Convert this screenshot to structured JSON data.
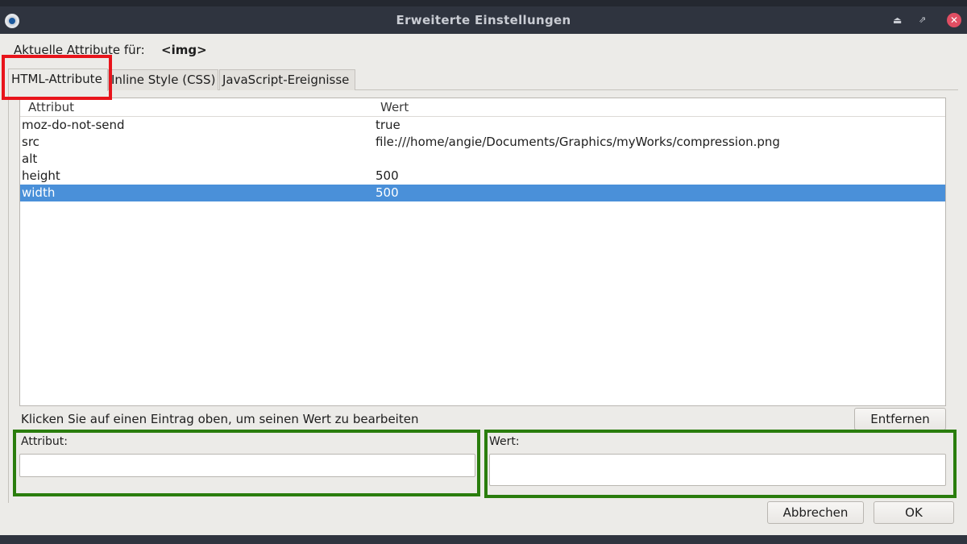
{
  "window": {
    "title": "Erweiterte Einstellungen"
  },
  "header": {
    "label": "Aktuelle Attribute für:",
    "element": "<img>"
  },
  "tabs": [
    {
      "label": "HTML-Attribute",
      "active": true
    },
    {
      "label": "Inline Style (CSS)",
      "active": false
    },
    {
      "label": "JavaScript-Ereignisse",
      "active": false
    }
  ],
  "table": {
    "columns": [
      "Attribut",
      "Wert"
    ],
    "rows": [
      {
        "attr": "moz-do-not-send",
        "value": "true"
      },
      {
        "attr": "src",
        "value": "file:///home/angie/Documents/Graphics/myWorks/compression.png"
      },
      {
        "attr": "alt",
        "value": ""
      },
      {
        "attr": "height",
        "value": "500"
      },
      {
        "attr": "width",
        "value": "500",
        "selected": true
      }
    ]
  },
  "hint": "Klicken Sie auf einen Eintrag oben, um seinen Wert zu bearbeiten",
  "buttons": {
    "remove": "Entfernen",
    "cancel": "Abbrechen",
    "ok": "OK"
  },
  "fields": {
    "attribute": {
      "label": "Attribut:",
      "value": ""
    },
    "value": {
      "label": "Wert:",
      "value": ""
    }
  },
  "colors": {
    "selection": "#4a90d9",
    "highlight_red": "#e8141b",
    "highlight_green": "#2a7d0d",
    "titlebar": "#2f343f"
  }
}
